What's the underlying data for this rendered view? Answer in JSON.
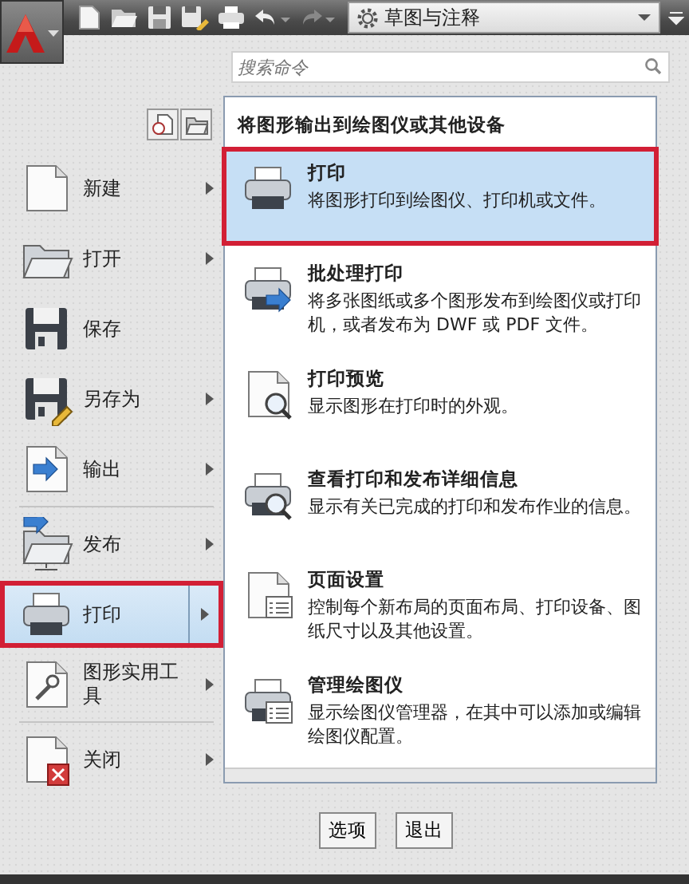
{
  "toolbar": {
    "workspace": "草图与注释"
  },
  "search": {
    "placeholder": "搜索命令"
  },
  "menu": [
    {
      "label": "新建",
      "submenu": true,
      "selected": false,
      "divider": false
    },
    {
      "label": "打开",
      "submenu": true,
      "selected": false,
      "divider": false
    },
    {
      "label": "保存",
      "submenu": false,
      "selected": false,
      "divider": false
    },
    {
      "label": "另存为",
      "submenu": true,
      "selected": false,
      "divider": false
    },
    {
      "label": "输出",
      "submenu": true,
      "selected": false,
      "divider": true
    },
    {
      "label": "发布",
      "submenu": true,
      "selected": false,
      "divider": false
    },
    {
      "label": "打印",
      "submenu": true,
      "selected": true,
      "divider": false
    },
    {
      "label": "图形实用工具",
      "submenu": true,
      "selected": false,
      "divider": true
    },
    {
      "label": "关闭",
      "submenu": true,
      "selected": false,
      "divider": false
    }
  ],
  "panel": {
    "title": "将图形输出到绘图仪或其他设备",
    "items": [
      {
        "title": "打印",
        "description": "将图形打印到绘图仪、打印机或文件。",
        "selected": true
      },
      {
        "title": "批处理打印",
        "description": "将多张图纸或多个图形发布到绘图仪或打印机，或者发布为 DWF 或 PDF 文件。",
        "selected": false
      },
      {
        "title": "打印预览",
        "description": "显示图形在打印时的外观。",
        "selected": false
      },
      {
        "title": "查看打印和发布详细信息",
        "description": "显示有关已完成的打印和发布作业的信息。",
        "selected": false
      },
      {
        "title": "页面设置",
        "description": "控制每个新布局的页面布局、打印设备、图纸尺寸以及其他设置。",
        "selected": false
      },
      {
        "title": "管理绘图仪",
        "description": "显示绘图仪管理器，在其中可以添加或编辑绘图仪配置。",
        "selected": false
      }
    ]
  },
  "buttons": [
    "选项",
    "退出"
  ]
}
